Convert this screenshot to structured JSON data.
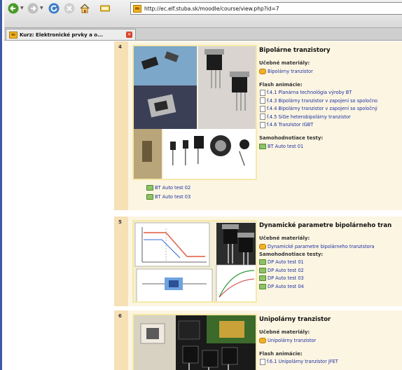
{
  "browser": {
    "url": "http://ec.elf.stuba.sk/moodle/course/view.php?id=7",
    "favicon": "m",
    "tab_title": "Kurz: Elektronické prvky a o...",
    "icons": [
      "back-arrow-icon",
      "forward-arrow-icon",
      "reload-icon",
      "stop-icon",
      "home-icon",
      "bookmark-icon"
    ]
  },
  "sections": [
    {
      "number": "4",
      "title": "Bipolárne tranzistory",
      "materials_label": "Učebné materiály:",
      "materials": [
        "Bipolárny tranzistor"
      ],
      "flash_label": "Flash animácie:",
      "flash": [
        "f.4.1 Planárna technológia výroby BT",
        "f.4.3 Bipolárny tranzistor v zapojení so spoločno",
        "f.4.4 Bipolárny tranzistor v zapojení so spoločný",
        "f.4.5 SiGe heterobipolárny tranzistor",
        "f.4.6 Tranzistor IGBT"
      ],
      "tests_label": "Samohodnotiace testy:",
      "tests": [
        "BT Auto test 01"
      ],
      "extra_tests": [
        "BT Auto test 02",
        "BT Auto test 03"
      ]
    },
    {
      "number": "5",
      "title": "Dynamické parametre bipolárneho tran",
      "materials_label": "Učebné materiály:",
      "materials": [
        "Dynamické parametre bipolárneho tranzistora"
      ],
      "tests_label": "Samohodnotiace testy:",
      "tests": [
        "DP Auto test 01",
        "DP Auto test 02",
        "DP Auto test 03",
        "DP Auto test 04"
      ]
    },
    {
      "number": "6",
      "title": "Unipolárny tranzistor",
      "materials_label": "Učebné materiály:",
      "materials": [
        "Unipolárny tranzistor"
      ],
      "flash_label": "Flash animácie:",
      "flash": [
        "f.6.1 Unipolárny tranzistor JFET"
      ]
    }
  ],
  "colors": {
    "week_number_bg": "#f6e0b5",
    "section_bg": "#fcf5e2",
    "link": "#1a2fa0",
    "frame_border": "#3a5aa8"
  }
}
